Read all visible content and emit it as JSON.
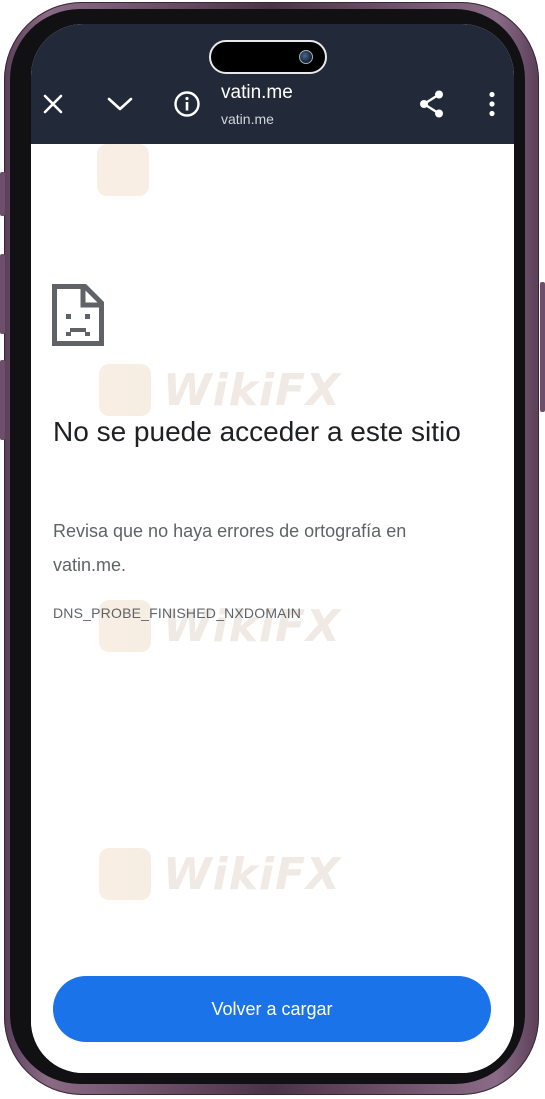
{
  "browser_bar": {
    "close_icon": "close-icon",
    "collapse_icon": "chevron-down-icon",
    "info_icon": "info-icon",
    "page_title": "vatin.me",
    "page_url": "vatin.me",
    "share_icon": "share-icon",
    "menu_icon": "more-vert-icon"
  },
  "error_page": {
    "icon": "sad-document-icon",
    "headline": "No se puede acceder a este sitio",
    "description": "Revisa que no haya errores de ortografía en vatin.me.",
    "error_code": "DNS_PROBE_FINISHED_NXDOMAIN",
    "reload_button_label": "Volver a cargar"
  },
  "watermark": {
    "text": "WikiFX"
  },
  "colors": {
    "toolbar_bg": "#222a3a",
    "primary_button": "#1a73e8",
    "headline_text": "#202124",
    "secondary_text": "#5f6368",
    "frame": "#6e4f6b"
  }
}
